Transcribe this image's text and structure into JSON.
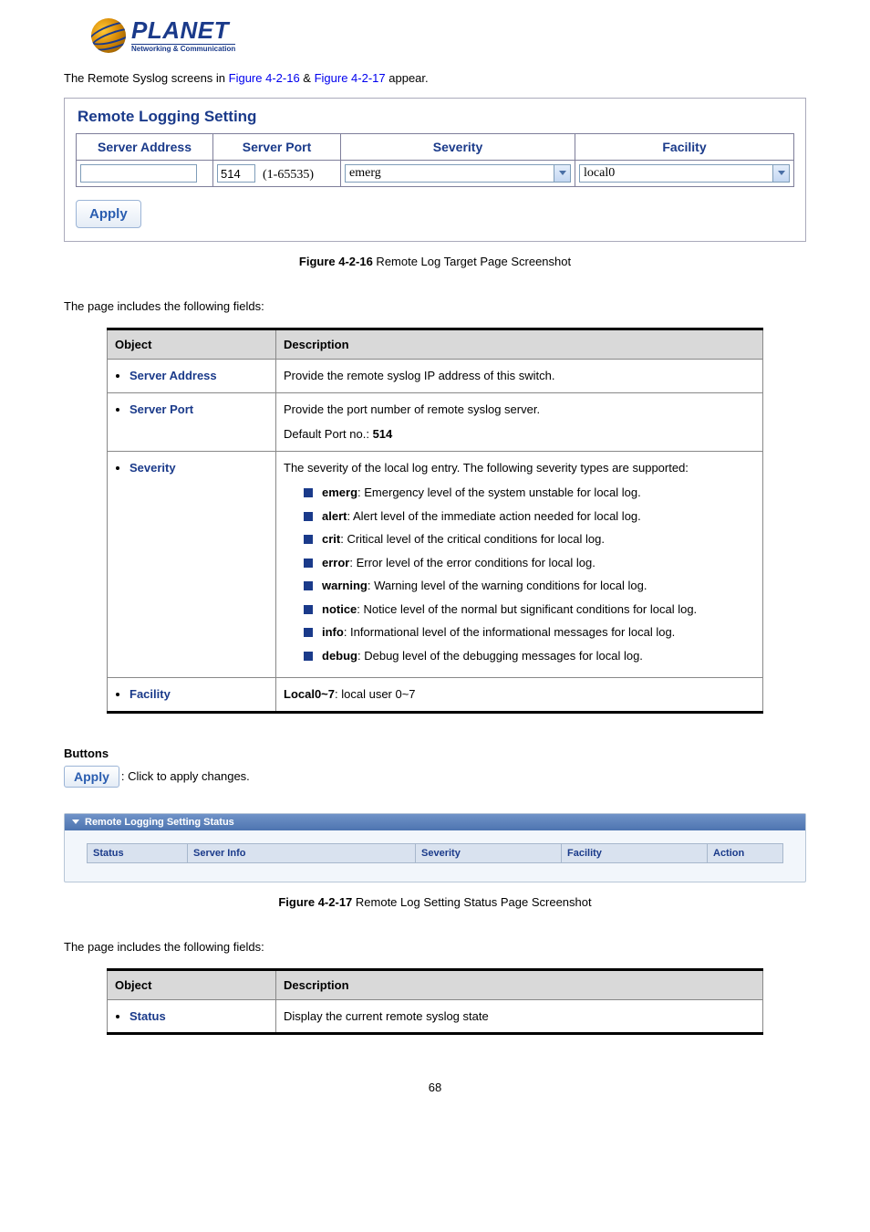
{
  "logo": {
    "name": "PLANET",
    "sub": "Networking & Communication"
  },
  "intro": {
    "pre": "The Remote Syslog screens in ",
    "link1": "Figure 4-2-16",
    "mid": " & ",
    "link2": "Figure 4-2-17",
    "post": " appear."
  },
  "shot1": {
    "title": "Remote Logging Setting",
    "headers": {
      "server_address": "Server Address",
      "server_port": "Server Port",
      "severity": "Severity",
      "facility": "Facility"
    },
    "values": {
      "server_address": "",
      "server_port": "514",
      "port_range": "(1-65535)",
      "severity": "emerg",
      "facility": "local0"
    },
    "apply": "Apply"
  },
  "caption1": {
    "bold": "Figure 4-2-16",
    "rest": " Remote Log Target Page Screenshot"
  },
  "fields_intro": "The page includes the following fields:",
  "table1": {
    "head": {
      "object": "Object",
      "description": "Description"
    },
    "rows": {
      "server_address": {
        "obj": "Server Address",
        "desc": "Provide the remote syslog IP address of this switch."
      },
      "server_port": {
        "obj": "Server Port",
        "desc_l1": "Provide the port number of remote syslog server.",
        "desc_l2_pre": "Default Port no.: ",
        "desc_l2_bold": "514"
      },
      "severity": {
        "obj": "Severity",
        "intro": "The severity of the local log entry. The following severity types are supported:",
        "items": [
          {
            "b": "emerg",
            "t": ": Emergency level of the system unstable for local log."
          },
          {
            "b": "alert",
            "t": ": Alert level of the immediate action needed for local log."
          },
          {
            "b": "crit",
            "t": ": Critical level of the critical conditions for local log."
          },
          {
            "b": "error",
            "t": ": Error level of the error conditions for local log."
          },
          {
            "b": "warning",
            "t": ": Warning level of the warning conditions for local log."
          },
          {
            "b": "notice",
            "t": ": Notice level of the normal but significant conditions for local log."
          },
          {
            "b": "info",
            "t": ": Informational level of the informational messages for local log."
          },
          {
            "b": "debug",
            "t": ": Debug level of the debugging messages for local log."
          }
        ]
      },
      "facility": {
        "obj": "Facility",
        "bold": "Local0~7",
        "rest": ": local user 0~7"
      }
    }
  },
  "buttons": {
    "heading": "Buttons",
    "apply": "Apply",
    "desc": ": Click to apply changes."
  },
  "shot2": {
    "title": "Remote Logging Setting Status",
    "headers": {
      "status": "Status",
      "server_info": "Server Info",
      "severity": "Severity",
      "facility": "Facility",
      "action": "Action"
    }
  },
  "caption2": {
    "bold": "Figure 4-2-17",
    "rest": " Remote Log Setting Status Page Screenshot"
  },
  "table2": {
    "head": {
      "object": "Object",
      "description": "Description"
    },
    "rows": {
      "status": {
        "obj": "Status",
        "desc": "Display the current remote syslog state"
      }
    }
  },
  "page_number": "68"
}
